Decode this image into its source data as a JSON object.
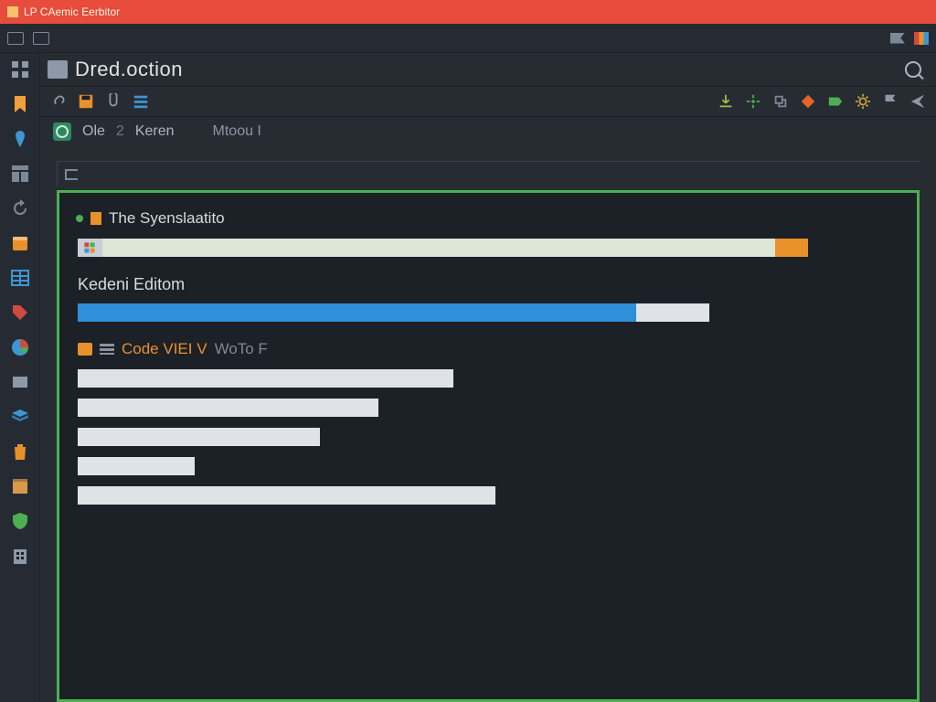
{
  "titlebar": {
    "title": "LP CAemic Eerbitor"
  },
  "header": {
    "title": "Dred.oction"
  },
  "breadcrumb": {
    "items": [
      "Ole",
      "2",
      "Keren",
      "Mtoou I"
    ]
  },
  "sidebar": {
    "items": [
      {
        "name": "grid-icon",
        "color": "#8d99a8",
        "shape": "grid"
      },
      {
        "name": "bookmark-icon",
        "color": "#f0a03c",
        "shape": "bookmark"
      },
      {
        "name": "pin-icon",
        "color": "#3e96d2",
        "shape": "pin"
      },
      {
        "name": "layout-icon",
        "color": "#7d8897",
        "shape": "layout"
      },
      {
        "name": "refresh-icon",
        "color": "#7d8897",
        "shape": "refresh"
      },
      {
        "name": "calendar-icon",
        "color": "#e8912b",
        "shape": "calendar"
      },
      {
        "name": "table-icon",
        "color": "#3e96d2",
        "shape": "table"
      },
      {
        "name": "tag-icon",
        "color": "#d24a3e",
        "shape": "tag"
      },
      {
        "name": "pie-icon",
        "color": "#e8912b",
        "shape": "pie"
      },
      {
        "name": "panel-icon",
        "color": "#8d99a8",
        "shape": "panel"
      },
      {
        "name": "stack-icon",
        "color": "#3e96d2",
        "shape": "stack"
      },
      {
        "name": "trash-icon",
        "color": "#e8912b",
        "shape": "trash"
      },
      {
        "name": "box-icon",
        "color": "#d89a4a",
        "shape": "box"
      },
      {
        "name": "shield-icon",
        "color": "#4caf50",
        "shape": "shield"
      },
      {
        "name": "building-icon",
        "color": "#8d99a8",
        "shape": "building"
      }
    ]
  },
  "toolbar": {
    "left": [
      {
        "name": "link-icon",
        "color": "#8d99a8"
      },
      {
        "name": "save-icon",
        "color": "#e8912b"
      },
      {
        "name": "audio-icon",
        "color": "#8d99a8"
      },
      {
        "name": "list-icon",
        "color": "#3e96d2"
      }
    ],
    "right": [
      {
        "name": "download-icon",
        "color": "#9bbf4d"
      },
      {
        "name": "target-icon",
        "color": "#4caf50"
      },
      {
        "name": "export-icon",
        "color": "#7d8897"
      },
      {
        "name": "diamond-icon",
        "color": "#e8642b"
      },
      {
        "name": "label-icon",
        "color": "#4caf50"
      },
      {
        "name": "gear-icon",
        "color": "#c9a23a"
      },
      {
        "name": "flag-icon",
        "color": "#8d99a8"
      },
      {
        "name": "send-icon",
        "color": "#8d99a8"
      }
    ]
  },
  "editor": {
    "section1": {
      "title": "The Syenslaatito"
    },
    "section2": {
      "title": "Kedeni Editom"
    },
    "section3": {
      "primary": "Code VIEI V",
      "secondary": "WoTo F"
    }
  },
  "chart_data": {
    "type": "bar",
    "title": "",
    "xlabel": "",
    "ylabel": "",
    "series": [
      {
        "name": "Syenslaatito",
        "segments": [
          {
            "label": "icon",
            "value": 3,
            "color": "#c9cfd6"
          },
          {
            "label": "fill",
            "value": 82,
            "color": "#dbe6d4"
          },
          {
            "label": "accent",
            "value": 4,
            "color": "#e8912b"
          },
          {
            "label": "empty",
            "value": 11,
            "color": "transparent"
          }
        ]
      },
      {
        "name": "Kedeni Editom",
        "segments": [
          {
            "label": "progress",
            "value": 68,
            "color": "#2f8fd8"
          },
          {
            "label": "remainder",
            "value": 9,
            "color": "#dfe3e8"
          },
          {
            "label": "empty",
            "value": 23,
            "color": "transparent"
          }
        ]
      },
      {
        "name": "Code-row-1",
        "segments": [
          {
            "label": "bar",
            "value": 45,
            "color": "#dfe3e8"
          }
        ]
      },
      {
        "name": "Code-row-2",
        "segments": [
          {
            "label": "bar",
            "value": 36,
            "color": "#dfe3e8"
          }
        ]
      },
      {
        "name": "Code-row-3",
        "segments": [
          {
            "label": "bar",
            "value": 29,
            "color": "#dfe3e8"
          }
        ]
      },
      {
        "name": "Code-row-4",
        "segments": [
          {
            "label": "bar",
            "value": 14,
            "color": "#dfe3e8"
          }
        ]
      },
      {
        "name": "Code-row-5",
        "segments": [
          {
            "label": "bar",
            "value": 50,
            "color": "#dfe3e8"
          }
        ]
      }
    ],
    "xlim": [
      0,
      100
    ]
  },
  "colors": {
    "accent_green": "#4caf50",
    "accent_orange": "#e8912b",
    "accent_blue": "#2f8fd8",
    "bg": "#272c33",
    "editor_bg": "#1c2027"
  }
}
